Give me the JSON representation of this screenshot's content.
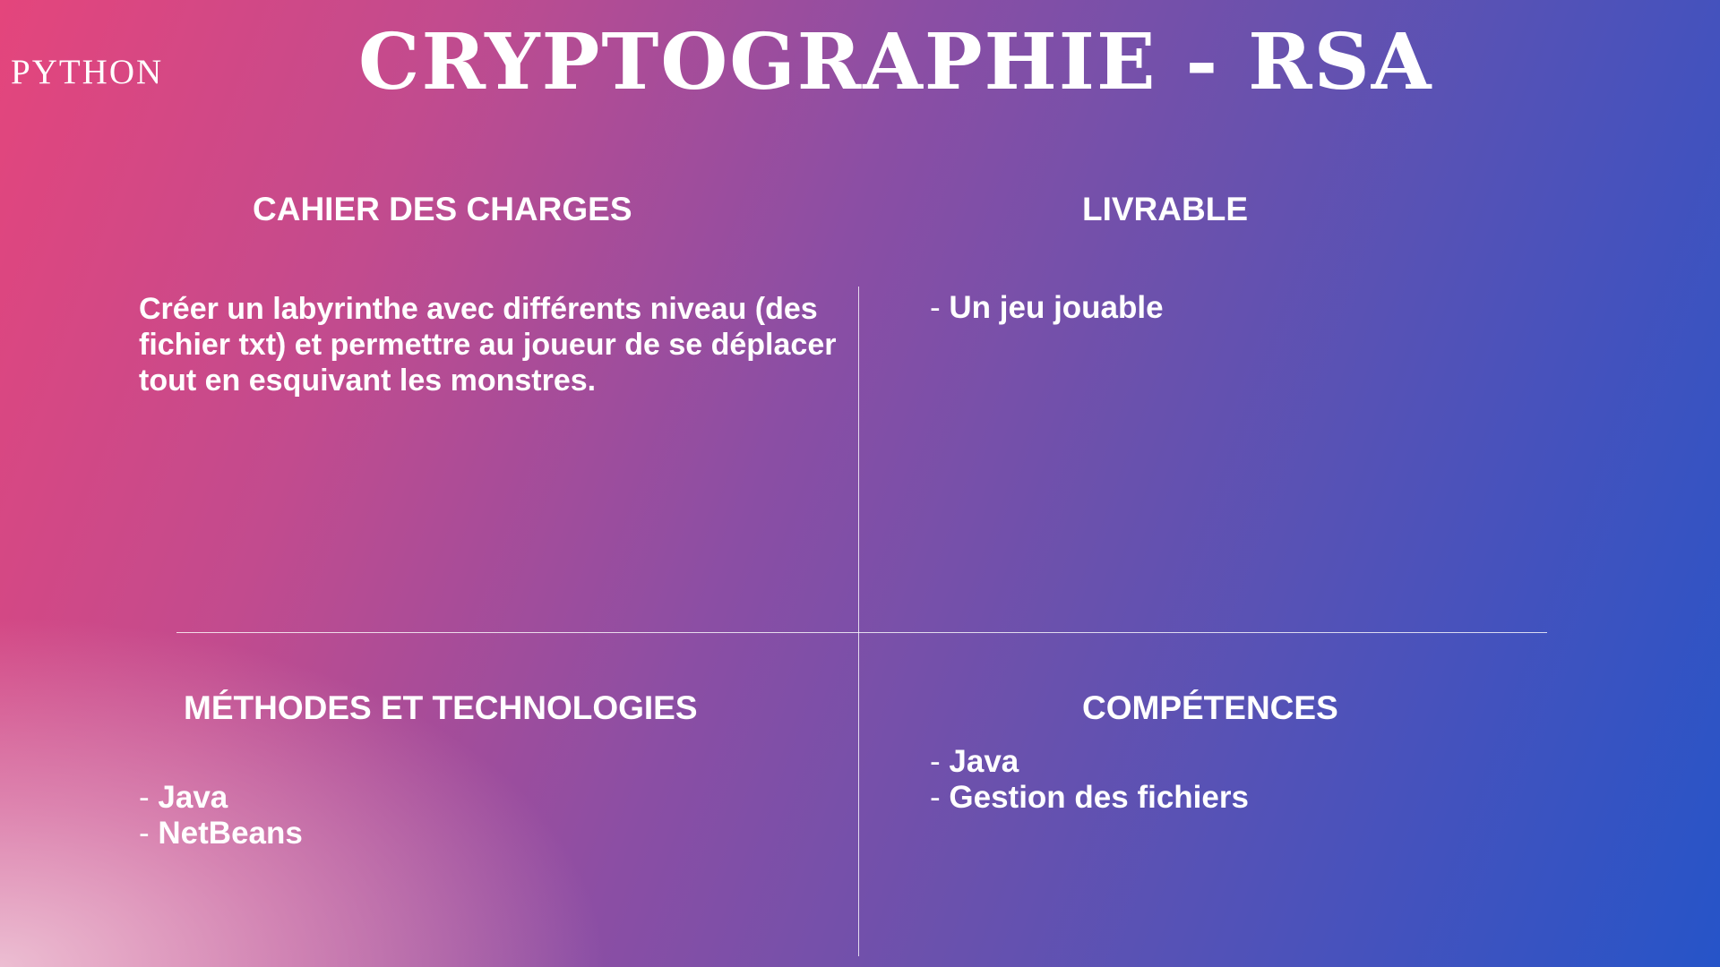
{
  "header": {
    "tag": "PYTHON",
    "title": "CRYPTOGRAPHIE - RSA"
  },
  "sections": {
    "cahier": {
      "heading": "CAHIER DES CHARGES",
      "text": "Créer un labyrinthe avec différents niveau (des fichier txt) et permettre au joueur de se déplacer tout en esquivant les monstres."
    },
    "livrable": {
      "heading": "LIVRABLE",
      "items": [
        "Un jeu jouable"
      ]
    },
    "methodes": {
      "heading": "MÉTHODES ET TECHNOLOGIES",
      "items": [
        "Java",
        "NetBeans"
      ]
    },
    "competences": {
      "heading": "COMPÉTENCES",
      "items": [
        "Java",
        "Gestion des fichiers"
      ]
    }
  },
  "colors": {
    "gradient_left": "#e4457c",
    "gradient_mid": "#8b4ea4",
    "gradient_right": "#2654c8",
    "text": "#ffffff"
  }
}
